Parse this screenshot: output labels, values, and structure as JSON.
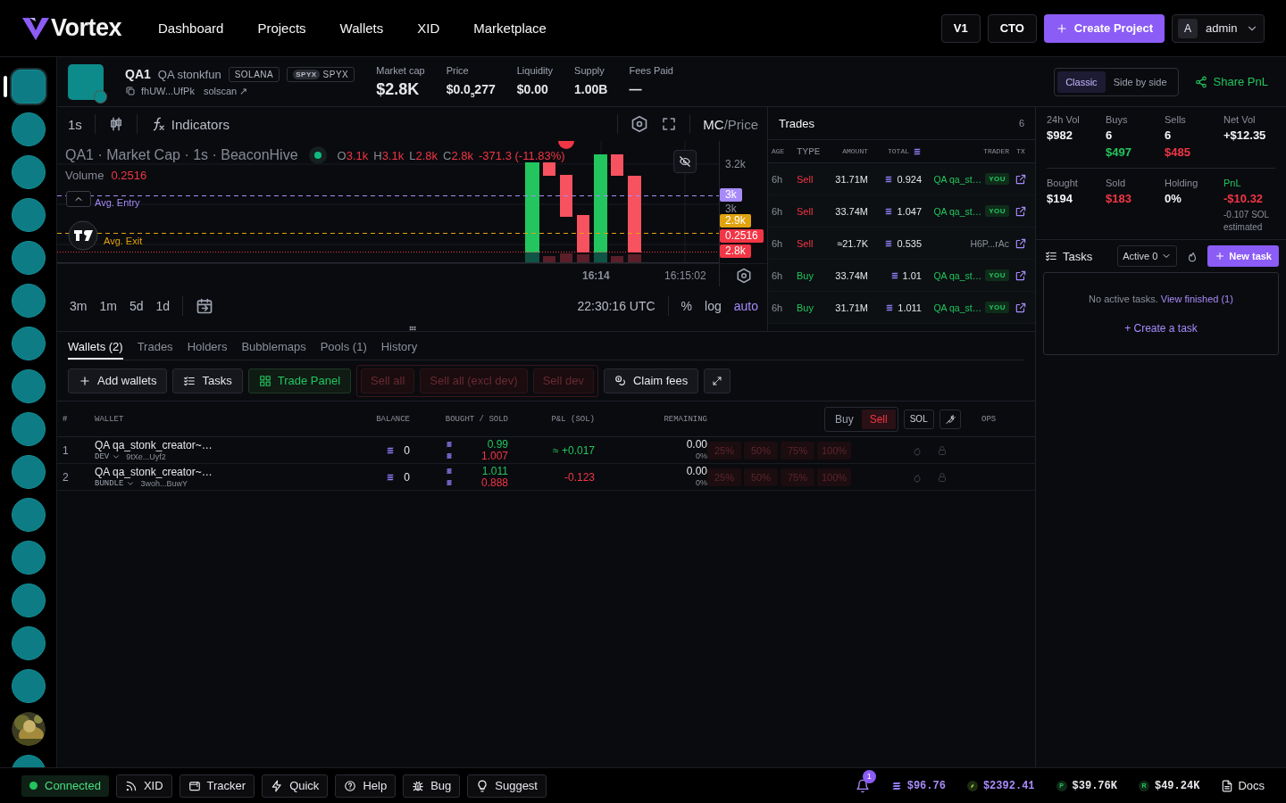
{
  "nav": {
    "logo": "Vortex",
    "links": [
      {
        "label": "Dashboard"
      },
      {
        "label": "Projects"
      },
      {
        "label": "Wallets"
      },
      {
        "label": "XID"
      },
      {
        "label": "Marketplace"
      }
    ],
    "version_buttons": [
      "V1",
      "CTO"
    ],
    "create_button": "Create Project",
    "user": {
      "initial": "A",
      "name": "admin"
    }
  },
  "rail": [
    {
      "kind": "coin",
      "selected": true
    },
    {
      "kind": "coin",
      "selected": false
    },
    {
      "kind": "coin",
      "selected": false
    },
    {
      "kind": "coin",
      "selected": false
    },
    {
      "kind": "coin",
      "selected": false
    },
    {
      "kind": "coin",
      "selected": false
    },
    {
      "kind": "coin",
      "selected": false
    },
    {
      "kind": "coin",
      "selected": false
    },
    {
      "kind": "coin",
      "selected": false
    },
    {
      "kind": "coin",
      "selected": false
    },
    {
      "kind": "coin",
      "selected": false
    },
    {
      "kind": "coin",
      "selected": false
    },
    {
      "kind": "coin",
      "selected": false
    },
    {
      "kind": "coin",
      "selected": false
    },
    {
      "kind": "coin",
      "selected": false
    },
    {
      "kind": "picture",
      "selected": false
    },
    {
      "kind": "coin",
      "selected": false
    }
  ],
  "token": {
    "symbol": "QA1",
    "name": "QA stonkfun",
    "tags": [
      {
        "label": "SOLANA"
      },
      {
        "badge": "SPYX",
        "label": "SPYX"
      }
    ],
    "address": "fhUW...UfPk",
    "explorer_link": "solscan ↗",
    "stats": [
      {
        "label": "Market cap",
        "value": "$2.8K",
        "large": true
      },
      {
        "label": "Price",
        "value": "$0.0$_{5}$277"
      },
      {
        "label": "Liquidity",
        "value": "$0.00"
      },
      {
        "label": "Supply",
        "value": "1.00B"
      },
      {
        "label": "Fees Paid",
        "value": "—"
      }
    ]
  },
  "layout_toggle": [
    {
      "label": "Classic",
      "selected": true
    },
    {
      "label": "Side by side",
      "selected": false
    }
  ],
  "share_button": "Share PnL",
  "chart": {
    "interval": "1s",
    "indicators": "Indicators",
    "mode": [
      {
        "label": "MC",
        "selected": true
      },
      {
        "label": "/Price",
        "selected": false
      }
    ],
    "legend": "QA1 · Market Cap · 1s · BeaconHive",
    "ohlc": [
      {
        "key": "O",
        "value": "3.1k"
      },
      {
        "key": "H",
        "value": "3.1k"
      },
      {
        "key": "L",
        "value": "2.8k"
      },
      {
        "key": "C",
        "value": "2.8k"
      }
    ],
    "change": "-371.3 (-11.83%)",
    "volume_label": "Volume",
    "volume_value": "0.2516",
    "lines": [
      {
        "label": "Avg. Entry",
        "kind": "entry"
      },
      {
        "label": "Avg. Exit",
        "kind": "exit"
      }
    ],
    "price_ticks": [
      "3.2k",
      "3k"
    ],
    "price_tags": [
      {
        "text": "3k",
        "color": "#a78bfa"
      },
      {
        "text": "2.9k",
        "color": "#e0a30f"
      },
      {
        "text": "0.2516",
        "color": "#f23645"
      },
      {
        "text": "2.8k",
        "color": "#f23645"
      }
    ],
    "time_labels": [
      {
        "text": "16:14",
        "bold": true
      },
      {
        "text": "16:15:02",
        "bold": false
      }
    ],
    "ranges": [
      "3m",
      "1m",
      "5d",
      "1d"
    ],
    "clock": "22:30:16 UTC",
    "scale": [
      {
        "label": "%",
        "selected": false
      },
      {
        "label": "log",
        "selected": false
      },
      {
        "label": "auto",
        "selected": true
      }
    ]
  },
  "trades": {
    "title": "Trades",
    "count": "6",
    "columns": [
      "AGE",
      "TYPE",
      "AMOUNT",
      "TOTAL",
      "TRADER",
      "TX"
    ],
    "rows": [
      {
        "age": "6h",
        "type": "Sell",
        "kind": "sell",
        "amount": "31.71M",
        "total": "0.924",
        "trader": "QA qa_st…",
        "own": true,
        "badge": "YOU"
      },
      {
        "age": "6h",
        "type": "Sell",
        "kind": "sell",
        "amount": "33.74M",
        "total": "1.047",
        "trader": "QA qa_st…",
        "own": true,
        "badge": "YOU"
      },
      {
        "age": "6h",
        "type": "Sell",
        "kind": "sell",
        "amount": "≈21.7K",
        "total": "0.535",
        "trader": "H6P...rAc",
        "own": false
      },
      {
        "age": "6h",
        "type": "Buy",
        "kind": "buy",
        "amount": "33.74M",
        "total": "1.01",
        "trader": "QA qa_st…",
        "own": true,
        "badge": "YOU"
      },
      {
        "age": "6h",
        "type": "Buy",
        "kind": "buy",
        "amount": "31.71M",
        "total": "1.011",
        "trader": "QA qa_st…",
        "own": true,
        "badge": "YOU"
      }
    ]
  },
  "stats": [
    [
      {
        "label": "24h Vol",
        "value": "$982"
      },
      {
        "label": "Buys",
        "value": "6",
        "sub": "$497",
        "sub_gain": true
      },
      {
        "label": "Sells",
        "value": "6",
        "sub": "$485",
        "sub_gain": false
      },
      {
        "label": "Net Vol",
        "value": "+$12.35"
      }
    ],
    [
      {
        "label": "Bought",
        "value": "$194"
      },
      {
        "label": "Sold",
        "value": "$183",
        "value_loss": true
      },
      {
        "label": "Holding",
        "value": "0%"
      },
      {
        "label": "PnL",
        "label_highlight": true,
        "value": "-$10.32",
        "value_loss": true,
        "note": "-0.107 SOL estimated"
      }
    ]
  ],
  "tasks": {
    "title": "Tasks",
    "filter": "Active 0",
    "new_button": "New task",
    "empty": "No active tasks.",
    "view_link": "View finished (1)",
    "create_link": "+ Create a task"
  },
  "wallets": {
    "tabs": [
      {
        "label": "Wallets (2)",
        "selected": true
      },
      {
        "label": "Trades",
        "selected": false
      },
      {
        "label": "Holders",
        "selected": false
      },
      {
        "label": "Bubblemaps",
        "selected": false
      },
      {
        "label": "Pools (1)",
        "selected": false
      },
      {
        "label": "History",
        "selected": false
      }
    ],
    "actions": [
      {
        "label": "Add wallets",
        "kind": "add"
      },
      {
        "label": "Tasks",
        "kind": "tasks"
      },
      {
        "label": "Trade Panel",
        "kind": "panel"
      }
    ],
    "sell_actions": [
      {
        "label": "Sell all",
        "disabled": true
      },
      {
        "label": "Sell all (excl dev)",
        "disabled": true
      },
      {
        "label": "Sell dev",
        "disabled": true
      }
    ],
    "claim_button": "Claim fees",
    "columns": [
      "#",
      "WALLET",
      "BALANCE",
      "BOUGHT / SOLD",
      "P&L (SOL)",
      "REMAINING",
      "OPS"
    ],
    "side_toggle": [
      {
        "label": "Buy",
        "selected": false
      },
      {
        "label": "Sell",
        "selected": true
      }
    ],
    "unit": "SOL",
    "rows": [
      {
        "index": "1",
        "name": "QA qa_stonk_creator~…",
        "role": "DEV",
        "address": "9tXe...Uyf2",
        "balance": "0",
        "bought": "0.99",
        "sold": "1.007",
        "pnl": "≈ +0.017",
        "pnl_gain": true,
        "remaining": "0.00",
        "remaining_pct": "0%",
        "presets": [
          "25%",
          "50%",
          "75%",
          "100%"
        ]
      },
      {
        "index": "2",
        "name": "QA qa_stonk_creator~…",
        "role": "BUNDLE",
        "address": "3woh...BuwY",
        "balance": "0",
        "bought": "1.011",
        "sold": "0.888",
        "pnl": "-0.123",
        "pnl_gain": false,
        "remaining": "0.00",
        "remaining_pct": "0%",
        "presets": [
          "25%",
          "50%",
          "75%",
          "100%"
        ]
      }
    ]
  },
  "status_bar": {
    "connection": {
      "label": "Connected",
      "online": true
    },
    "tools": [
      {
        "label": "XID",
        "kind": "xid"
      },
      {
        "label": "Tracker",
        "kind": "tracker"
      },
      {
        "label": "Quick",
        "kind": "quick"
      },
      {
        "label": "Help",
        "kind": "help"
      },
      {
        "label": "Bug",
        "kind": "bug"
      },
      {
        "label": "Suggest",
        "kind": "suggest"
      }
    ],
    "notifications": "1",
    "balances": [
      {
        "kind": "sol",
        "value": "$96.76"
      },
      {
        "kind": "eth",
        "value": "$2392.41"
      },
      {
        "kind": "coin",
        "badge": "P",
        "value": "$39.76K"
      },
      {
        "kind": "coin",
        "badge": "R",
        "value": "$49.24K"
      }
    ],
    "docs": "Docs"
  }
}
